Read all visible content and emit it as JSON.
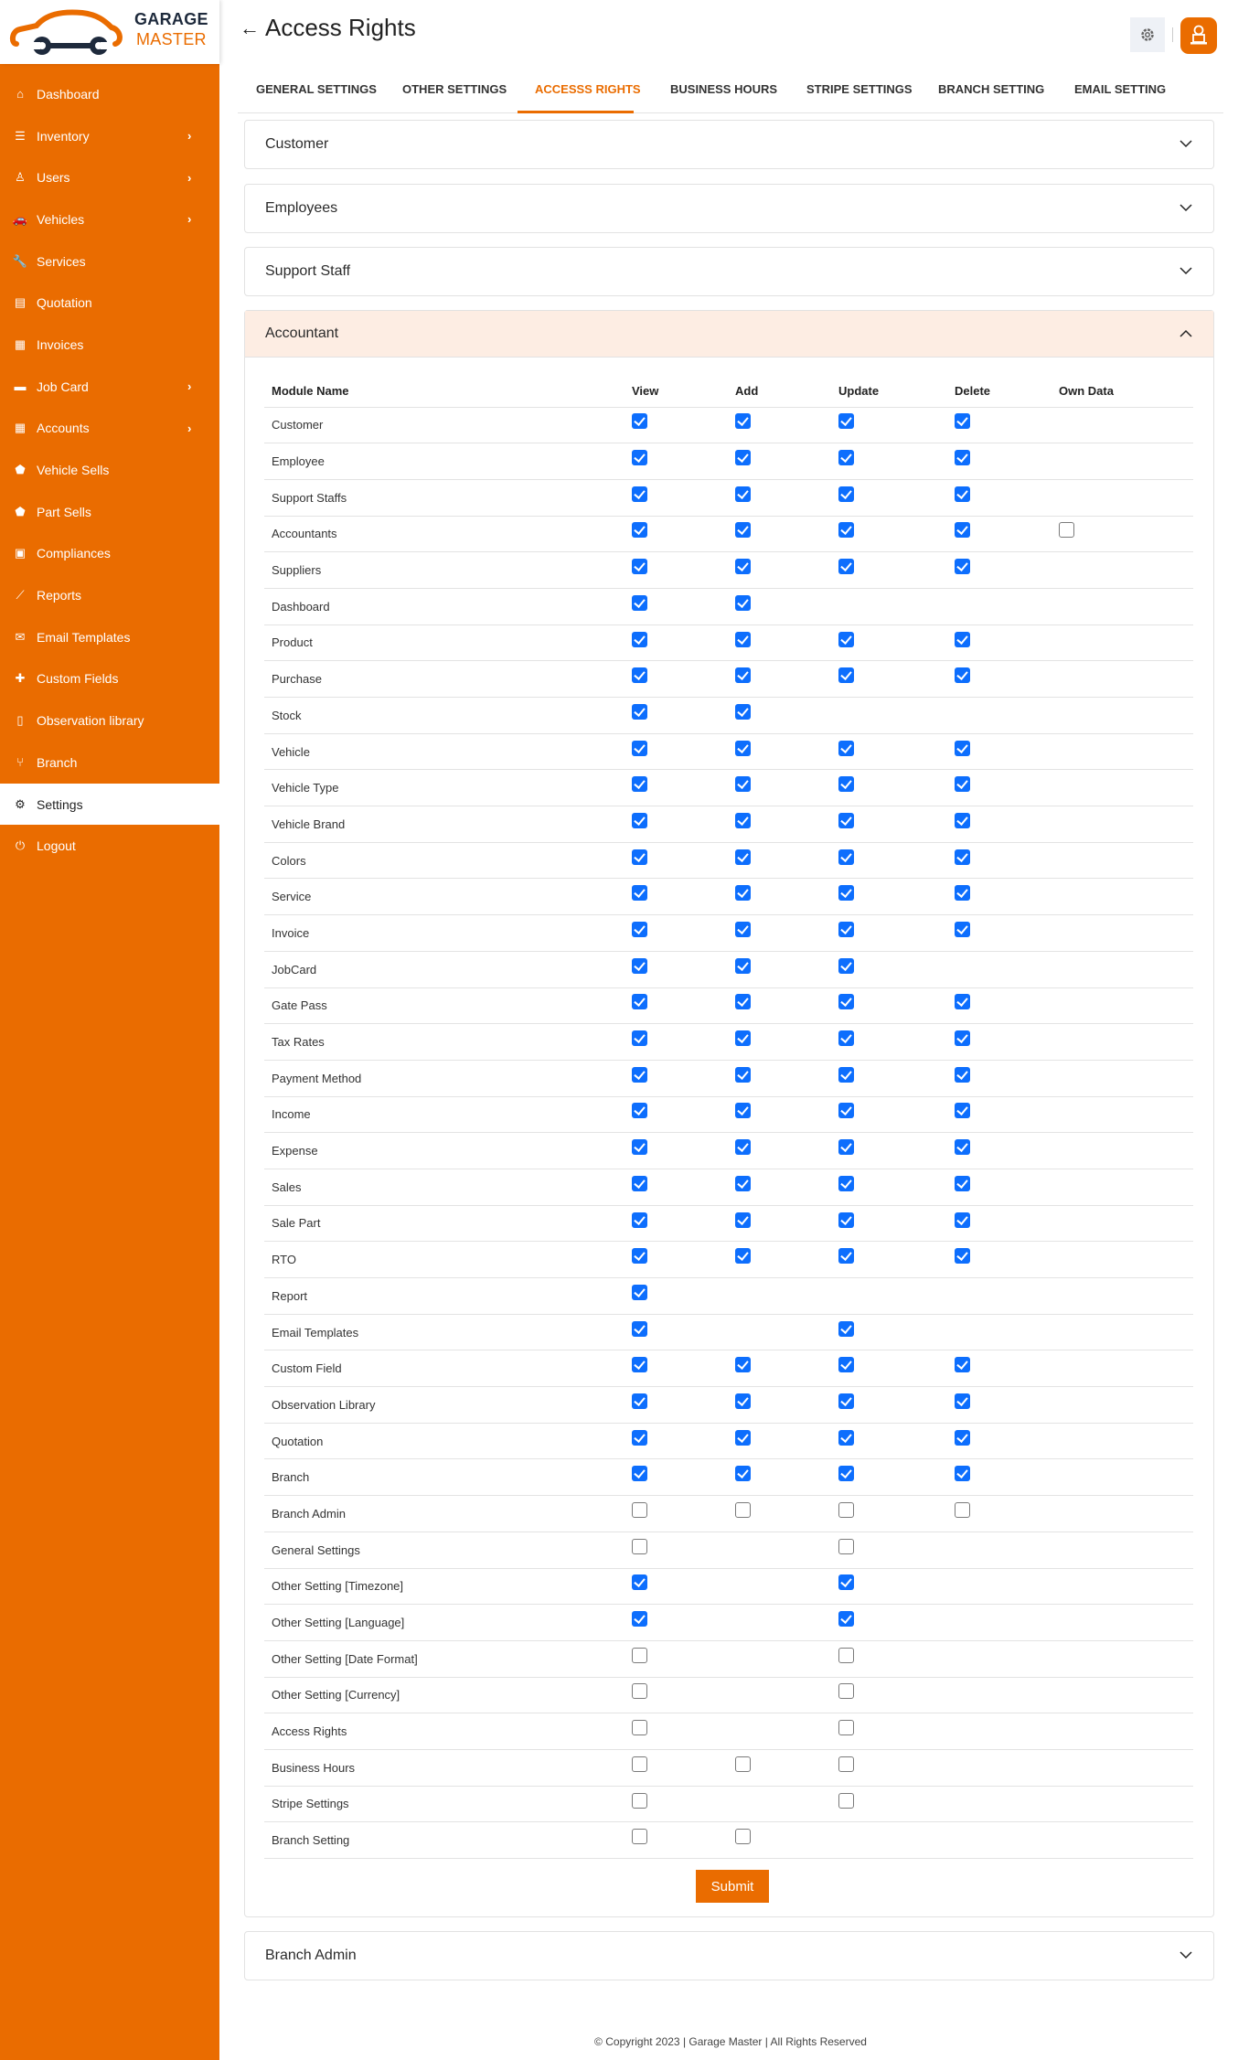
{
  "brand": {
    "line1": "GARAGE",
    "line2": "MASTER",
    "accent": "#ea6c00"
  },
  "sidebar": {
    "items": [
      {
        "label": "Dashboard",
        "icon": "home-icon",
        "has_submenu": false,
        "active": false
      },
      {
        "label": "Inventory",
        "icon": "sliders-icon",
        "has_submenu": true,
        "active": false
      },
      {
        "label": "Users",
        "icon": "user-icon",
        "has_submenu": true,
        "active": false
      },
      {
        "label": "Vehicles",
        "icon": "car-icon",
        "has_submenu": true,
        "active": false
      },
      {
        "label": "Services",
        "icon": "wrench-icon",
        "has_submenu": false,
        "active": false
      },
      {
        "label": "Quotation",
        "icon": "file-invoice-dollar-icon",
        "has_submenu": false,
        "active": false
      },
      {
        "label": "Invoices",
        "icon": "receipt-icon",
        "has_submenu": false,
        "active": false
      },
      {
        "label": "Job Card",
        "icon": "credit-card-icon",
        "has_submenu": true,
        "active": false
      },
      {
        "label": "Accounts",
        "icon": "calculator-icon",
        "has_submenu": true,
        "active": false
      },
      {
        "label": "Vehicle Sells",
        "icon": "tag-icon",
        "has_submenu": false,
        "active": false
      },
      {
        "label": "Part Sells",
        "icon": "tag-icon",
        "has_submenu": false,
        "active": false
      },
      {
        "label": "Compliances",
        "icon": "clipboard-check-icon",
        "has_submenu": false,
        "active": false
      },
      {
        "label": "Reports",
        "icon": "chart-line-icon",
        "has_submenu": false,
        "active": false
      },
      {
        "label": "Email Templates",
        "icon": "envelope-open-icon",
        "has_submenu": false,
        "active": false
      },
      {
        "label": "Custom Fields",
        "icon": "puzzle-icon",
        "has_submenu": false,
        "active": false
      },
      {
        "label": "Observation library",
        "icon": "file-icon",
        "has_submenu": false,
        "active": false
      },
      {
        "label": "Branch",
        "icon": "code-branch-icon",
        "has_submenu": false,
        "active": false
      },
      {
        "label": "Settings",
        "icon": "gear-icon",
        "has_submenu": false,
        "active": true
      },
      {
        "label": "Logout",
        "icon": "power-icon",
        "has_submenu": false,
        "active": false
      }
    ]
  },
  "header": {
    "title": "Access Rights",
    "back_icon": "arrow-left-icon",
    "settings_icon": "gear-icon",
    "avatar_icon": "user-avatar-icon"
  },
  "tabs": [
    {
      "label": "GENERAL SETTINGS",
      "active": false
    },
    {
      "label": "OTHER SETTINGS",
      "active": false
    },
    {
      "label": "ACCESSS RIGHTS",
      "active": true
    },
    {
      "label": "BUSINESS HOURS",
      "active": false
    },
    {
      "label": "STRIPE SETTINGS",
      "active": false
    },
    {
      "label": "BRANCH SETTING",
      "active": false
    },
    {
      "label": "EMAIL SETTING",
      "active": false
    }
  ],
  "accordions": {
    "collapsed_top": [
      "Customer",
      "Employees",
      "Support Staff"
    ],
    "open": "Accountant",
    "collapsed_bottom": [
      "Branch Admin"
    ]
  },
  "table": {
    "columns": [
      "Module Name",
      "View",
      "Add",
      "Update",
      "Delete",
      "Own Data"
    ],
    "rows": [
      {
        "module": "Customer",
        "view": true,
        "add": true,
        "update": true,
        "delete": true,
        "own": null
      },
      {
        "module": "Employee",
        "view": true,
        "add": true,
        "update": true,
        "delete": true,
        "own": null
      },
      {
        "module": "Support Staffs",
        "view": true,
        "add": true,
        "update": true,
        "delete": true,
        "own": null
      },
      {
        "module": "Accountants",
        "view": true,
        "add": true,
        "update": true,
        "delete": true,
        "own": false
      },
      {
        "module": "Suppliers",
        "view": true,
        "add": true,
        "update": true,
        "delete": true,
        "own": null
      },
      {
        "module": "Dashboard",
        "view": true,
        "add": true,
        "update": null,
        "delete": null,
        "own": null
      },
      {
        "module": "Product",
        "view": true,
        "add": true,
        "update": true,
        "delete": true,
        "own": null
      },
      {
        "module": "Purchase",
        "view": true,
        "add": true,
        "update": true,
        "delete": true,
        "own": null
      },
      {
        "module": "Stock",
        "view": true,
        "add": true,
        "update": null,
        "delete": null,
        "own": null
      },
      {
        "module": "Vehicle",
        "view": true,
        "add": true,
        "update": true,
        "delete": true,
        "own": null
      },
      {
        "module": "Vehicle Type",
        "view": true,
        "add": true,
        "update": true,
        "delete": true,
        "own": null
      },
      {
        "module": "Vehicle Brand",
        "view": true,
        "add": true,
        "update": true,
        "delete": true,
        "own": null
      },
      {
        "module": "Colors",
        "view": true,
        "add": true,
        "update": true,
        "delete": true,
        "own": null
      },
      {
        "module": "Service",
        "view": true,
        "add": true,
        "update": true,
        "delete": true,
        "own": null
      },
      {
        "module": "Invoice",
        "view": true,
        "add": true,
        "update": true,
        "delete": true,
        "own": null
      },
      {
        "module": "JobCard",
        "view": true,
        "add": true,
        "update": true,
        "delete": null,
        "own": null
      },
      {
        "module": "Gate Pass",
        "view": true,
        "add": true,
        "update": true,
        "delete": true,
        "own": null
      },
      {
        "module": "Tax Rates",
        "view": true,
        "add": true,
        "update": true,
        "delete": true,
        "own": null
      },
      {
        "module": "Payment Method",
        "view": true,
        "add": true,
        "update": true,
        "delete": true,
        "own": null
      },
      {
        "module": "Income",
        "view": true,
        "add": true,
        "update": true,
        "delete": true,
        "own": null
      },
      {
        "module": "Expense",
        "view": true,
        "add": true,
        "update": true,
        "delete": true,
        "own": null
      },
      {
        "module": "Sales",
        "view": true,
        "add": true,
        "update": true,
        "delete": true,
        "own": null
      },
      {
        "module": "Sale Part",
        "view": true,
        "add": true,
        "update": true,
        "delete": true,
        "own": null
      },
      {
        "module": "RTO",
        "view": true,
        "add": true,
        "update": true,
        "delete": true,
        "own": null
      },
      {
        "module": "Report",
        "view": true,
        "add": null,
        "update": null,
        "delete": null,
        "own": null
      },
      {
        "module": "Email Templates",
        "view": true,
        "add": null,
        "update": true,
        "delete": null,
        "own": null
      },
      {
        "module": "Custom Field",
        "view": true,
        "add": true,
        "update": true,
        "delete": true,
        "own": null
      },
      {
        "module": "Observation Library",
        "view": true,
        "add": true,
        "update": true,
        "delete": true,
        "own": null
      },
      {
        "module": "Quotation",
        "view": true,
        "add": true,
        "update": true,
        "delete": true,
        "own": null
      },
      {
        "module": "Branch",
        "view": true,
        "add": true,
        "update": true,
        "delete": true,
        "own": null
      },
      {
        "module": "Branch Admin",
        "view": false,
        "add": false,
        "update": false,
        "delete": false,
        "own": null
      },
      {
        "module": "General Settings",
        "view": false,
        "add": null,
        "update": false,
        "delete": null,
        "own": null
      },
      {
        "module": "Other Setting [Timezone]",
        "view": true,
        "add": null,
        "update": true,
        "delete": null,
        "own": null
      },
      {
        "module": "Other Setting [Language]",
        "view": true,
        "add": null,
        "update": true,
        "delete": null,
        "own": null
      },
      {
        "module": "Other Setting [Date Format]",
        "view": false,
        "add": null,
        "update": false,
        "delete": null,
        "own": null
      },
      {
        "module": "Other Setting [Currency]",
        "view": false,
        "add": null,
        "update": false,
        "delete": null,
        "own": null
      },
      {
        "module": "Access Rights",
        "view": false,
        "add": null,
        "update": false,
        "delete": null,
        "own": null
      },
      {
        "module": "Business Hours",
        "view": false,
        "add": false,
        "update": false,
        "delete": null,
        "own": null
      },
      {
        "module": "Stripe Settings",
        "view": false,
        "add": null,
        "update": false,
        "delete": null,
        "own": null
      },
      {
        "module": "Branch Setting",
        "view": false,
        "add": false,
        "update": null,
        "delete": null,
        "own": null
      }
    ]
  },
  "submit_label": "Submit",
  "footer": "© Copyright 2023 | Garage Master | All Rights Reserved",
  "colors": {
    "accent": "#ea6c00",
    "checkbox_checked": "#0d6efd",
    "open_accordion_bg": "#fdede3"
  }
}
